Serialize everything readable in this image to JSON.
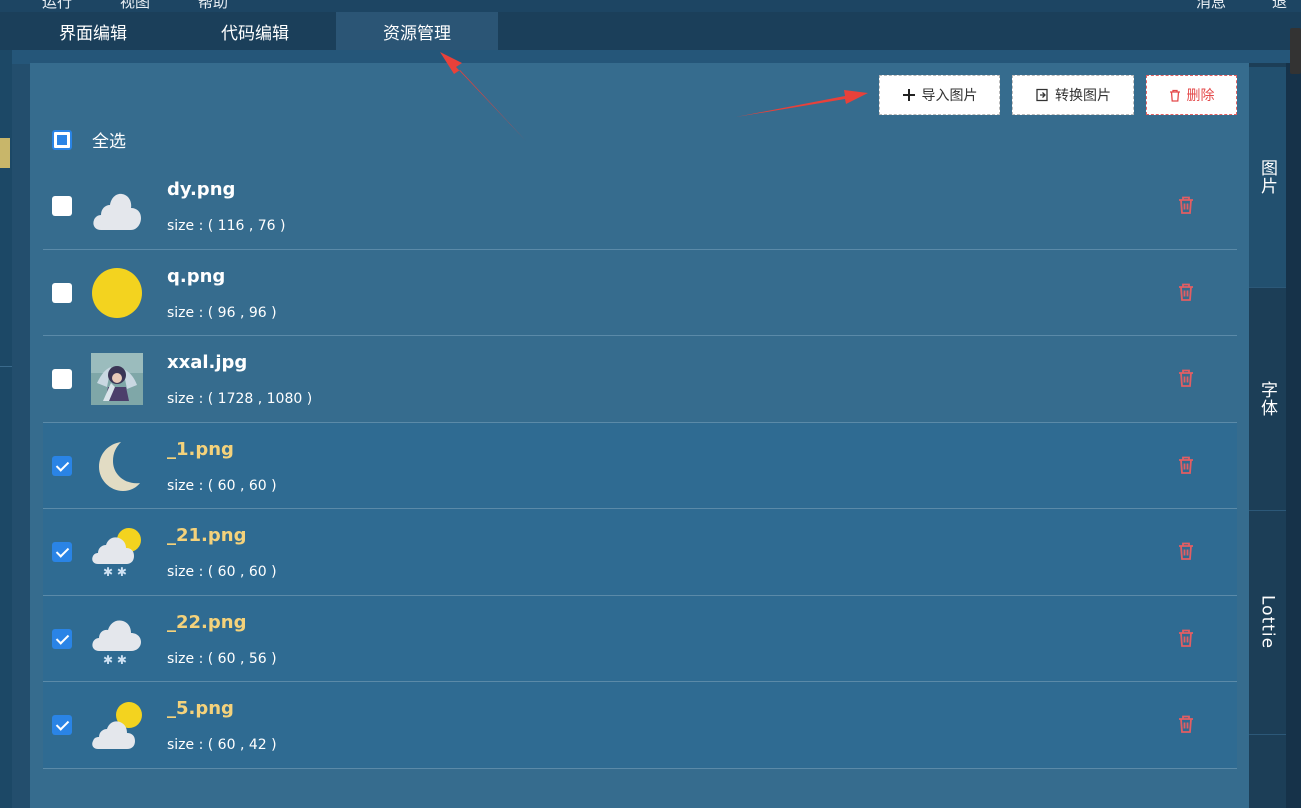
{
  "menu": {
    "items": [
      "运行",
      "视图",
      "帮助"
    ],
    "right_items": [
      "消息",
      "退出"
    ]
  },
  "tabs": [
    {
      "label": "界面编辑",
      "active": false
    },
    {
      "label": "代码编辑",
      "active": false
    },
    {
      "label": "资源管理",
      "active": true
    }
  ],
  "toolbar": {
    "import_label": "导入图片",
    "convert_label": "转换图片",
    "delete_label": "删除"
  },
  "select_all": {
    "label": "全选",
    "state": "indeterminate"
  },
  "files": [
    {
      "name": "dy.png",
      "size": "size : ( 116 , 76 )",
      "checked": false,
      "thumb": "cloud-icon"
    },
    {
      "name": "q.png",
      "size": "size : ( 96 , 96 )",
      "checked": false,
      "thumb": "sun-icon"
    },
    {
      "name": "xxal.jpg",
      "size": "size : ( 1728 , 1080 )",
      "checked": false,
      "thumb": "photo-thumbnail"
    },
    {
      "name": "_1.png",
      "size": "size : ( 60 , 60 )",
      "checked": true,
      "thumb": "moon-icon"
    },
    {
      "name": "_21.png",
      "size": "size : ( 60 , 60 )",
      "checked": true,
      "thumb": "snow-sun-cloud-icon"
    },
    {
      "name": "_22.png",
      "size": "size : ( 60 , 56 )",
      "checked": true,
      "thumb": "snow-cloud-icon"
    },
    {
      "name": "_5.png",
      "size": "size : ( 60 , 42 )",
      "checked": true,
      "thumb": "sun-cloud-icon"
    }
  ],
  "side_tabs": [
    {
      "label": "图片",
      "active": true
    },
    {
      "label": "字体",
      "active": false
    },
    {
      "label": "Lottie",
      "active": false
    }
  ],
  "colors": {
    "accent": "#2a84e6",
    "danger": "#e4494a",
    "selected_name": "#f4d27b",
    "annotation_arrow": "#e8413a"
  }
}
